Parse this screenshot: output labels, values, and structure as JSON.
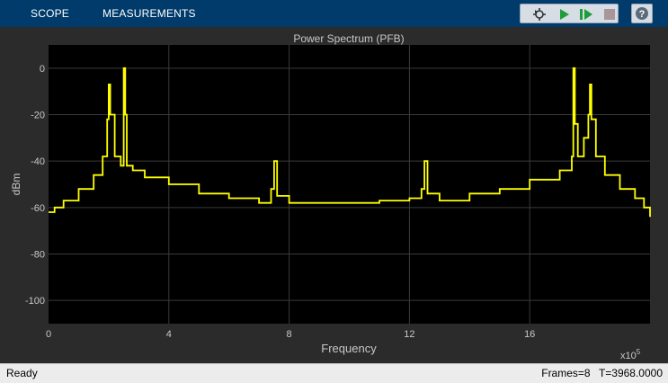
{
  "toolstrip": {
    "tabs": [
      {
        "label": "SCOPE"
      },
      {
        "label": "MEASUREMENTS"
      }
    ],
    "help_label": "?"
  },
  "plot": {
    "title": "Power Spectrum (PFB)",
    "xlabel": "Frequency",
    "ylabel": "dBm",
    "exponent": "x10",
    "exponent_power": "5",
    "line_color": "#ffff00",
    "background": "#000000",
    "axes_color": "#2b2b2b"
  },
  "chart_data": {
    "type": "line",
    "title": "Power Spectrum (PFB)",
    "xlabel": "Frequency",
    "ylabel": "dBm",
    "x_scale_note": "x10^5",
    "xlim": [
      0,
      20
    ],
    "ylim": [
      -110,
      10
    ],
    "xticks": [
      0,
      4,
      8,
      12,
      16
    ],
    "yticks": [
      0,
      -20,
      -40,
      -60,
      -80,
      -100
    ],
    "grid": true,
    "series": [
      {
        "color": "#ffff00",
        "x": [
          0,
          0.2,
          0.5,
          1.0,
          1.5,
          1.8,
          1.95,
          2.0,
          2.05,
          2.2,
          2.4,
          2.5,
          2.55,
          2.6,
          2.8,
          3.2,
          4,
          5,
          6,
          7,
          7.4,
          7.5,
          7.6,
          8,
          9,
          10,
          11,
          12,
          12.4,
          12.5,
          12.6,
          13,
          14,
          15,
          16,
          17,
          17.4,
          17.45,
          17.5,
          17.6,
          17.8,
          17.95,
          18.0,
          18.05,
          18.2,
          18.5,
          19,
          19.5,
          19.8,
          20
        ],
        "y": [
          -62,
          -60,
          -57,
          -52,
          -46,
          -38,
          -22,
          -7,
          -20,
          -38,
          -42,
          0,
          -20,
          -42,
          -44,
          -47,
          -50,
          -54,
          -56,
          -58,
          -52,
          -40,
          -55,
          -58,
          -58,
          -58,
          -57,
          -56,
          -52,
          -40,
          -54,
          -57,
          -54,
          -52,
          -48,
          -44,
          -38,
          0,
          -24,
          -38,
          -30,
          -20,
          -7,
          -22,
          -38,
          -46,
          -52,
          -56,
          -60,
          -64
        ]
      }
    ]
  },
  "status": {
    "left": "Ready",
    "frames": "Frames=8",
    "time": "T=3968.0000"
  }
}
